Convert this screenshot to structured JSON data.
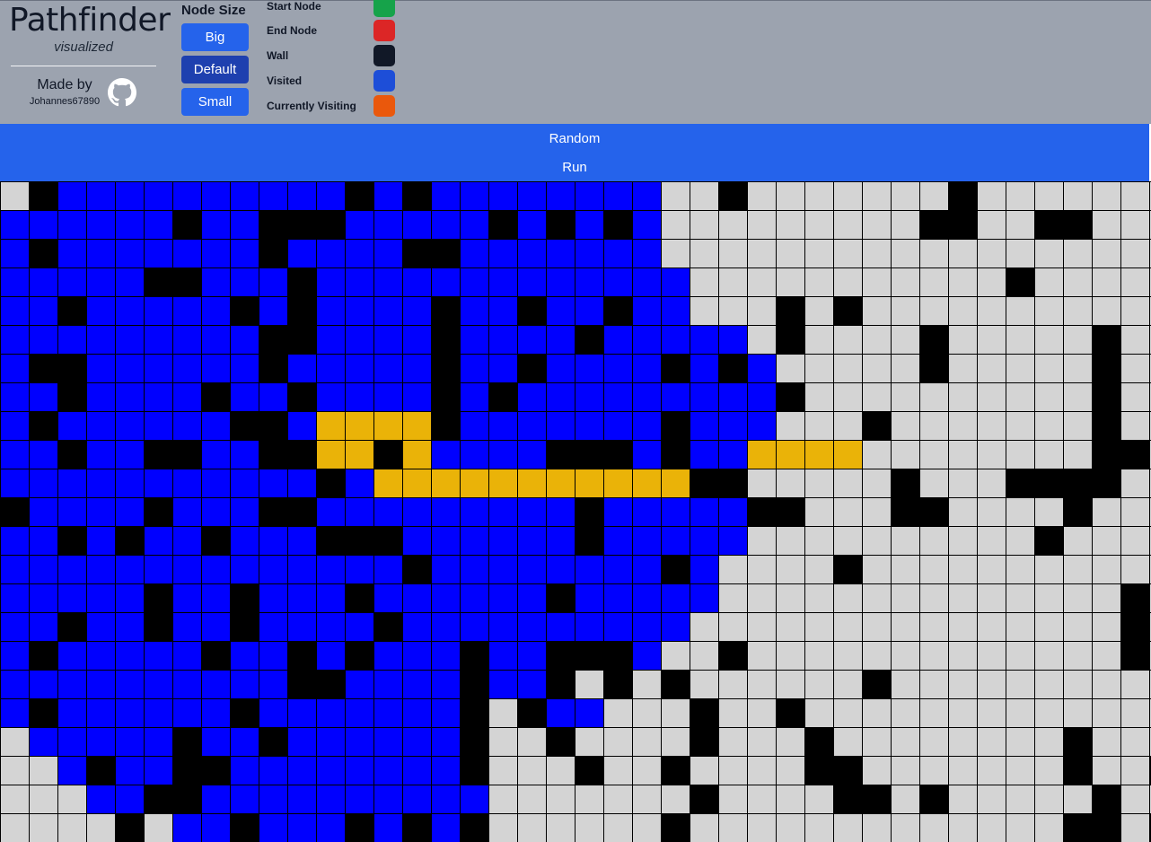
{
  "brand": {
    "title": "Pathfinder",
    "subtitle": "visualized"
  },
  "made_by": {
    "label": "Made by",
    "author": "Johannes67890",
    "icon": "github-icon"
  },
  "node_size": {
    "title": "Node Size",
    "big": "Big",
    "default": "Default",
    "small": "Small"
  },
  "legend": [
    {
      "label": "Start Node",
      "color": "#16a34a"
    },
    {
      "label": "End Node",
      "color": "#dc2626"
    },
    {
      "label": "Wall",
      "color": "#111827"
    },
    {
      "label": "Visited",
      "color": "#1d4ed8"
    },
    {
      "label": "Currently Visiting",
      "color": "#ea580c"
    }
  ],
  "actions": {
    "random": "Random",
    "run": "Run"
  },
  "grid": {
    "colors": {
      ".": "#d4d4d4",
      "#": "#000000",
      "v": "#0000ff",
      "p": "#eab308"
    },
    "legend_codes": {
      ".": "empty",
      "#": "wall",
      "v": "visited",
      "p": "path"
    },
    "rows": [
      ".#vvvvvvvvvv#v#vvvvvvvv..#.......#.........#",
      "vvvvvv#vv###vvvvv#v#v#v.........##..##......",
      "v#vvvvvvv#vvvv##vvvvvvv.....................",
      "vvvvv##vvv#vvvvvvvvvvvvv...........#........",
      "vv#vvvvv#v#vvvv#vv#vv#vv...#.#..............",
      "vvvvvvvvv##vvvv#vvvv#vvvvv.#....#.....#.....",
      "v##vvvvvv#vvvvv#vv#vvvv#v#v.....#.....#....#",
      "vv#vvvv#vv#vvvv#v#vvvvvvvvv#..........#.....",
      "v#vvvvvv##vpppp#vvvvvvv#vvv...#.......#...##",
      "vv#vv##vv##pp#pvvvv###v#vvpppp........##.#..",
      "vvvvvvvvvvv#vppppppppppp##.....#...####....#",
      "#vvvv#vvv##vvvvvvvvv#vvvvv##...##....#......",
      "vv#v#vv#vvv###vvvvvv#vvvvv..........#.......",
      "vvvvvvvvvvvvvv#vvvvvvvv#v....#..............",
      "vvvvv#vv#vvv#vvvvvv#vvvvv..............#.#.#",
      "vv#vv#vv#vvvv#vvvvvvvvvv...............#..#.",
      "v#vvvvv#vv#v#vvv#vv###v..#.............#....",
      "vvvvvvvvvv##vvvv#vv#.#.#......#.............",
      "v#vvvvvv#vvvvvvv#.#vv...#..#................",
      ".vvvvv#vv#vvvvvv#..#....#...#........#......",
      "..v#vv##vvvvvvvv#...#..#....##.......#..#...",
      "...vv##vvvvvvvvvv.......#....##.#.....#.....",
      "....#.vv#vvv#v#v#......#.............##.#..."
    ]
  }
}
